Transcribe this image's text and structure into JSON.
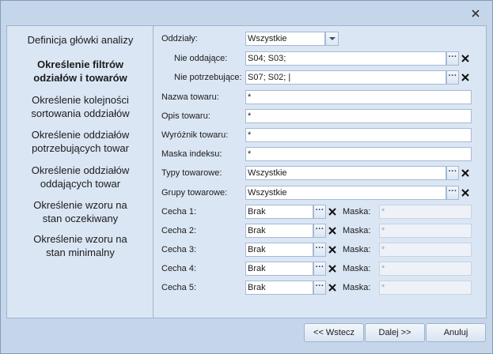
{
  "sidebar": {
    "steps": [
      "Definicja główki analizy",
      "Określenie filtrów odziałów i towarów",
      "Określenie kolejności sortowania oddziałów",
      "Określenie oddziałów potrzebujących towar",
      "Określenie oddziałów oddających towar",
      "Określenie wzoru na stan oczekiwany",
      "Określenie wzoru na stan minimalny"
    ]
  },
  "form": {
    "oddzialy": {
      "label": "Oddziały:",
      "value": "Wszystkie"
    },
    "nie_oddajace": {
      "label": "Nie oddające:",
      "value": "S04; S03;"
    },
    "nie_potrzebujace": {
      "label": "Nie potrzebujące:",
      "value": "S07; S02; |"
    },
    "nazwa_towaru": {
      "label": "Nazwa towaru:",
      "value": "*"
    },
    "opis_towaru": {
      "label": "Opis towaru:",
      "value": "*"
    },
    "wyroznik_towaru": {
      "label": "Wyróżnik towaru:",
      "value": "*"
    },
    "maska_indeksu": {
      "label": "Maska indeksu:",
      "value": "*"
    },
    "typy_towarowe": {
      "label": "Typy towarowe:",
      "value": "Wszystkie"
    },
    "grupy_towarowe": {
      "label": "Grupy towarowe:",
      "value": "Wszystkie"
    },
    "cechy": [
      {
        "label": "Cecha 1:",
        "value": "Brak",
        "maska_label": "Maska:",
        "maska_value": "*"
      },
      {
        "label": "Cecha 2:",
        "value": "Brak",
        "maska_label": "Maska:",
        "maska_value": "*"
      },
      {
        "label": "Cecha 3:",
        "value": "Brak",
        "maska_label": "Maska:",
        "maska_value": "*"
      },
      {
        "label": "Cecha 4:",
        "value": "Brak",
        "maska_label": "Maska:",
        "maska_value": "*"
      },
      {
        "label": "Cecha 5:",
        "value": "Brak",
        "maska_label": "Maska:",
        "maska_value": "*"
      }
    ],
    "browse_glyph": "···"
  },
  "buttons": {
    "back": "<< Wstecz",
    "next": "Dalej >>",
    "cancel": "Anuluj"
  },
  "icons": {
    "close": "close-icon",
    "clear": "clear-x-icon",
    "browse": "ellipsis-icon",
    "dropdown": "chevron-down-icon"
  }
}
